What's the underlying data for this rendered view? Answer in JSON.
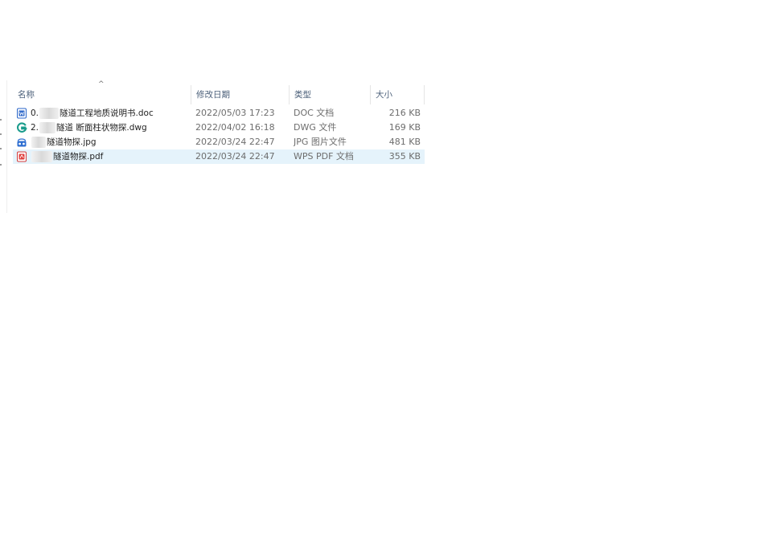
{
  "columns": {
    "name": "名称",
    "modified": "修改日期",
    "type": "类型",
    "size": "大小"
  },
  "sort_indicator": "^",
  "files": [
    {
      "prefix": "0.",
      "name": "隧道工程地质说明书.doc",
      "modified": "2022/05/03 17:23",
      "type": "DOC 文档",
      "size": "216 KB",
      "icon": "word-doc-icon",
      "selected": false
    },
    {
      "prefix": "2.",
      "name": "隧道 断面柱状物探.dwg",
      "modified": "2022/04/02 16:18",
      "type": "DWG 文件",
      "size": "169 KB",
      "icon": "cad-dwg-icon",
      "selected": false
    },
    {
      "prefix": "",
      "name": "隧道物探.jpg",
      "modified": "2022/03/24 22:47",
      "type": "JPG 图片文件",
      "size": "481 KB",
      "icon": "image-viewer-icon",
      "selected": false
    },
    {
      "prefix": "",
      "name": "隧道物探.pdf",
      "modified": "2022/03/24 22:47",
      "type": "WPS PDF 文档",
      "size": "355 KB",
      "icon": "wps-pdf-icon",
      "selected": true
    }
  ],
  "colors": {
    "header_text": "#4c607a",
    "selected_row": "#e5f3fb"
  }
}
